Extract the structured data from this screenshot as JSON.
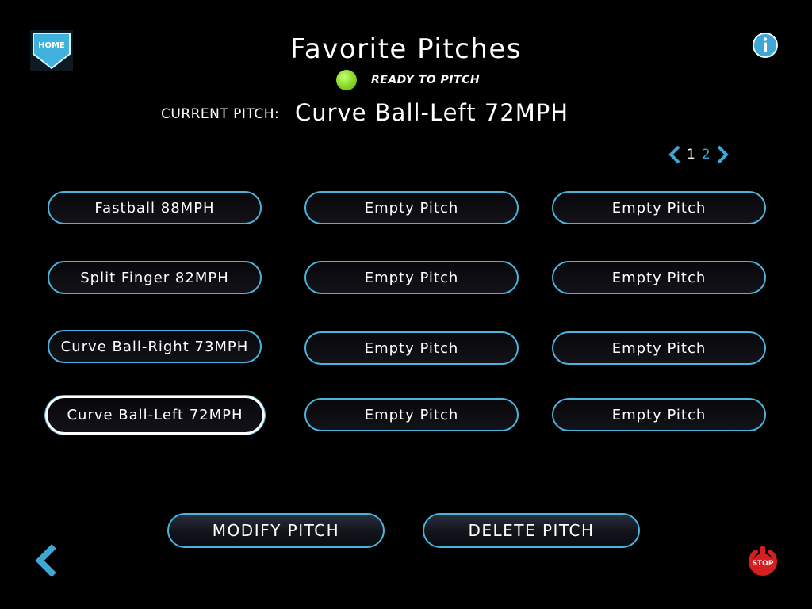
{
  "header": {
    "home_label": "HOME",
    "title": "Favorite Pitches",
    "status_text": "READY TO PITCH",
    "status_color": "#8ee02c"
  },
  "current": {
    "label": "CURRENT PITCH:",
    "value": "Curve Ball-Left 72MPH"
  },
  "pager": {
    "pages": [
      "1",
      "2"
    ],
    "active_page": "1"
  },
  "pitches": {
    "r0c0": "Fastball 88MPH",
    "r0c1": "Empty Pitch",
    "r0c2": "Empty Pitch",
    "r1c0": "Split Finger 82MPH",
    "r1c1": "Empty Pitch",
    "r1c2": "Empty Pitch",
    "r2c0": "Curve Ball-Right 73MPH",
    "r2c1": "Empty Pitch",
    "r2c2": "Empty Pitch",
    "r3c0": "Curve Ball-Left 72MPH",
    "r3c1": "Empty Pitch",
    "r3c2": "Empty Pitch"
  },
  "selected_pitch": "Curve Ball-Left 72MPH",
  "actions": {
    "modify_label": "MODIFY PITCH",
    "delete_label": "DELETE PITCH"
  },
  "footer": {
    "stop_label": "STOP"
  },
  "icons": {
    "home": "home-plate-icon",
    "info": "info-icon",
    "back": "chevron-left-icon",
    "stop": "power-stop-icon",
    "page_prev": "chevron-left-icon",
    "page_next": "chevron-right-icon"
  },
  "colors": {
    "accent": "#4cb4dc",
    "background": "#000000",
    "stop_red": "#d42020"
  }
}
